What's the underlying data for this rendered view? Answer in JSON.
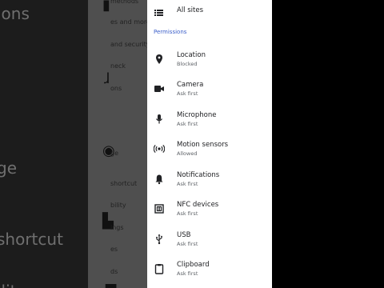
{
  "background": {
    "left_fragments": [
      "ions",
      "l",
      "ge",
      "shortcut",
      "ilit"
    ],
    "mid_fragments": [
      "methods",
      "es and more",
      "and security",
      "neck",
      "ons",
      "ge",
      "shortcut",
      "bility",
      "ings",
      "es",
      "ds"
    ]
  },
  "panel": {
    "all_sites_label": "All sites",
    "section_header": "Permissions",
    "items": [
      {
        "title": "Location",
        "subtitle": "Blocked",
        "icon": "location-pin-icon"
      },
      {
        "title": "Camera",
        "subtitle": "Ask first",
        "icon": "camera-icon"
      },
      {
        "title": "Microphone",
        "subtitle": "Ask first",
        "icon": "microphone-icon"
      },
      {
        "title": "Motion sensors",
        "subtitle": "Allowed",
        "icon": "motion-sensor-icon"
      },
      {
        "title": "Notifications",
        "subtitle": "Ask first",
        "icon": "bell-icon"
      },
      {
        "title": "NFC devices",
        "subtitle": "Ask first",
        "icon": "nfc-icon"
      },
      {
        "title": "USB",
        "subtitle": "Ask first",
        "icon": "usb-icon"
      },
      {
        "title": "Clipboard",
        "subtitle": "Ask first",
        "icon": "clipboard-icon"
      }
    ]
  },
  "colors": {
    "accent": "#3b5ec9",
    "panel_bg": "#ffffff"
  }
}
